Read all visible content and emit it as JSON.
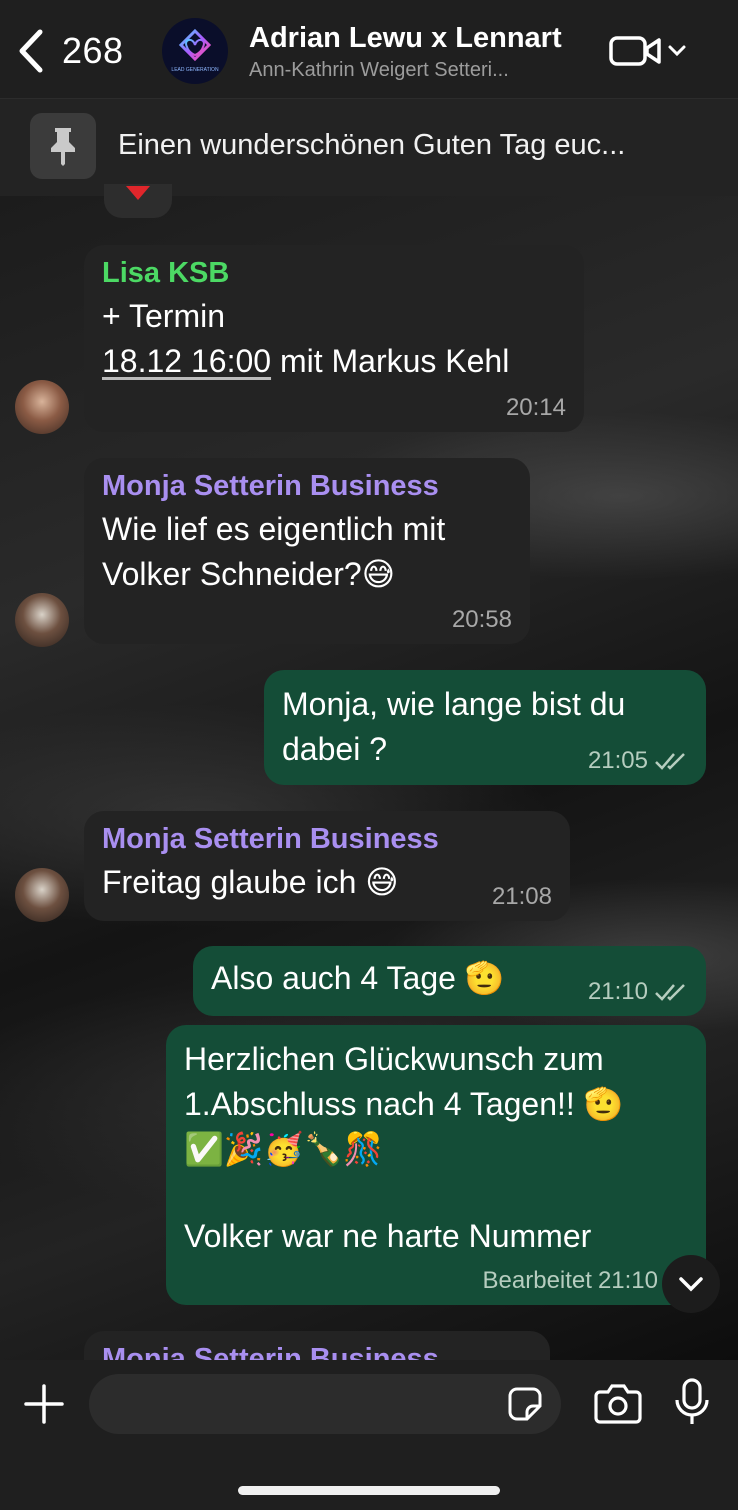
{
  "header": {
    "back_count": "268",
    "title": "Adrian Lewu x Lennart",
    "subtitle": "Ann-Kathrin Weigert Setteri...",
    "avatar_label": "LEAD GENERATION"
  },
  "pinned": {
    "text": "Einen wunderschönen Guten Tag euc..."
  },
  "messages": [
    {
      "sender": "Lisa KSB",
      "line1": "+ Termin",
      "date_link": "18.12 16:00",
      "line2_rest": " mit Markus Kehl",
      "time": "20:14"
    },
    {
      "sender": "Monja Setterin Business",
      "text_line1": "Wie lief es eigentlich mit",
      "text_line2": "Volker Schneider?😅",
      "time": "20:58"
    },
    {
      "text_line1": "Monja, wie lange bist du",
      "text_line2": "dabei ?",
      "time": "21:05"
    },
    {
      "sender": "Monja Setterin Business",
      "text": "Freitag glaube ich 😅",
      "time": "21:08"
    },
    {
      "text": "Also auch 4 Tage 🫡",
      "time": "21:10"
    },
    {
      "text_line1": "Herzlichen Glückwunsch zum",
      "text_line2": "1.Abschluss nach 4 Tagen!! 🫡",
      "text_line3": "✅🎉🥳🍾🎊",
      "text_line4": "Volker war ne harte Nummer",
      "edited": "Bearbeitet",
      "time": "21:10"
    },
    {
      "sender": "Monja Setterin Business"
    }
  ],
  "colors": {
    "lisa_name": "#4cd964",
    "monja_name": "#a98ff0",
    "outgoing_bubble": "#144d37",
    "incoming_bubble": "#232323"
  },
  "icons": [
    "chevron-left-icon",
    "video-call-icon",
    "pin-icon",
    "checkmark-double-icon",
    "chevron-down-icon",
    "plus-icon",
    "sticker-icon",
    "camera-icon",
    "mic-icon"
  ]
}
